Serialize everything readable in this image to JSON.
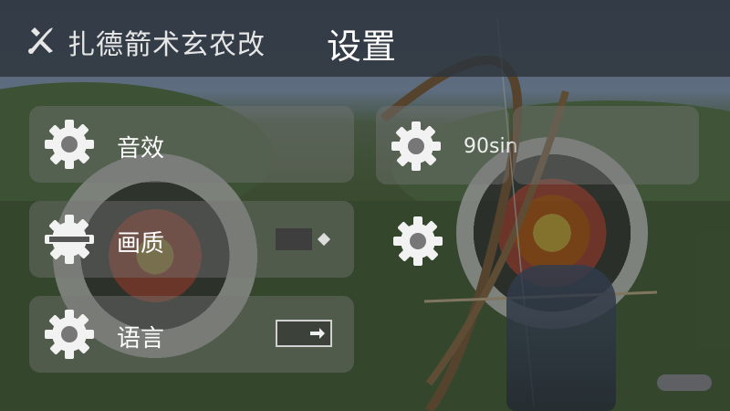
{
  "header": {
    "game_title": "扎德箭术玄农改",
    "screen_title": "设置"
  },
  "settings": {
    "sound": {
      "label": "音效",
      "icon": "gear-icon"
    },
    "quality": {
      "label": "画质",
      "icon": "gear-icon"
    },
    "language": {
      "label": "语言",
      "icon": "gear-icon"
    },
    "right_top": {
      "value": "90sin",
      "icon": "gear-icon"
    },
    "right_mid": {
      "icon": "gear-icon"
    }
  },
  "colors": {
    "topbar": "#2d343c",
    "panel": "#787878",
    "text": "#ffffff"
  }
}
